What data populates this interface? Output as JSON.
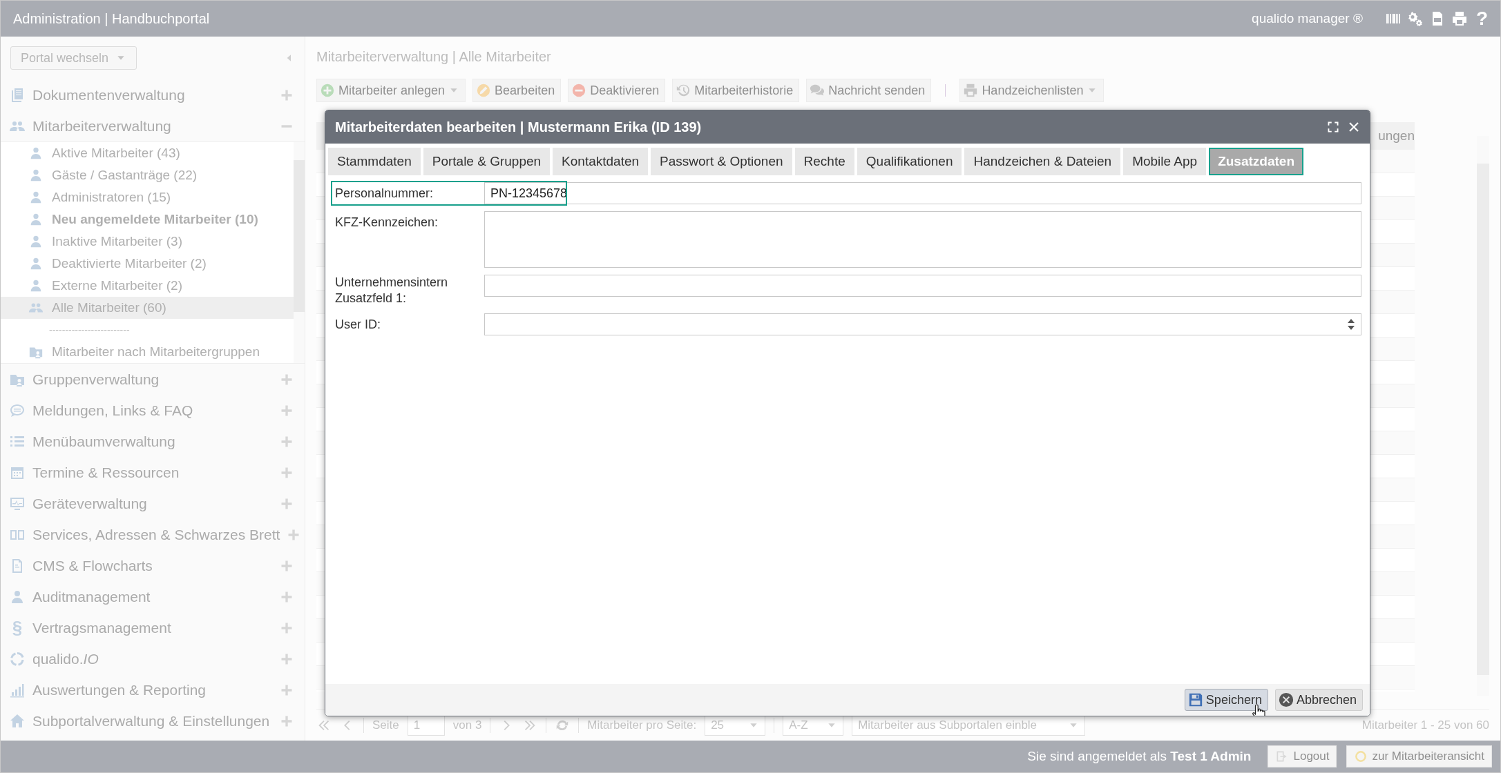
{
  "header": {
    "title": "Administration | Handbuchportal",
    "product": "qualido manager ®",
    "help": "?"
  },
  "sidebar": {
    "portal_select": "Portal wechseln",
    "sections": [
      {
        "label": "Dokumentenverwaltung",
        "expanded": false
      },
      {
        "label": "Mitarbeiterverwaltung",
        "expanded": true,
        "children": [
          {
            "kind": "item",
            "label": "Aktive Mitarbeiter (43)",
            "selected": false,
            "bold": false
          },
          {
            "kind": "item",
            "label": "Gäste / Gastanträge (22)",
            "selected": false,
            "bold": false
          },
          {
            "kind": "item",
            "label": "Administratoren (15)",
            "selected": false,
            "bold": false
          },
          {
            "kind": "item",
            "label": "Neu angemeldete Mitarbeiter (10)",
            "selected": false,
            "bold": true
          },
          {
            "kind": "item",
            "label": "Inaktive Mitarbeiter (3)",
            "selected": false,
            "bold": false
          },
          {
            "kind": "item",
            "label": "Deaktivierte Mitarbeiter (2)",
            "selected": false,
            "bold": false
          },
          {
            "kind": "item",
            "label": "Externe Mitarbeiter (2)",
            "selected": false,
            "bold": false
          },
          {
            "kind": "item",
            "label": "Alle Mitarbeiter (60)",
            "selected": true,
            "bold": false
          },
          {
            "kind": "separator",
            "label": "-------------------------"
          },
          {
            "kind": "item",
            "label": "Mitarbeiter nach Mitarbeitergruppen",
            "selected": false,
            "bold": false
          }
        ]
      },
      {
        "label": "Gruppenverwaltung",
        "expanded": false
      },
      {
        "label": "Meldungen, Links & FAQ",
        "expanded": false
      },
      {
        "label": "Menübaumverwaltung",
        "expanded": false
      },
      {
        "label": "Termine & Ressourcen",
        "expanded": false
      },
      {
        "label": "Geräteverwaltung",
        "expanded": false
      },
      {
        "label": "Services, Adressen & Schwarzes Brett",
        "expanded": false
      },
      {
        "label": "CMS & Flowcharts",
        "expanded": false
      },
      {
        "label": "Auditmanagement",
        "expanded": false
      },
      {
        "label": "Vertragsmanagement",
        "expanded": false,
        "icon_glyph": "§"
      },
      {
        "label": "qualido.*IO*",
        "expanded": false
      },
      {
        "label": "Auswertungen & Reporting",
        "expanded": false
      },
      {
        "label": "Subportalverwaltung & Einstellungen",
        "expanded": false
      }
    ]
  },
  "main": {
    "title": "Mitarbeiterverwaltung | Alle Mitarbeiter",
    "toolbar": [
      {
        "label": "Mitarbeiter anlegen",
        "dropdown": true
      },
      {
        "label": "Bearbeiten",
        "dropdown": false
      },
      {
        "label": "Deaktivieren",
        "dropdown": false
      },
      {
        "label": "Mitarbeiterhistorie",
        "dropdown": false
      },
      {
        "label": "Nachricht senden",
        "dropdown": false
      },
      {
        "label": "Handzeichenlisten",
        "dropdown": true
      }
    ],
    "table": {
      "column_header": "ungen"
    },
    "pager": {
      "page_label": "Seite",
      "page": "1",
      "of": "von 3",
      "per_page_label": "Mitarbeiter pro Seite:",
      "per_page": "25",
      "sort": "A-Z",
      "subportal": "Mitarbeiter aus Subportalen einble",
      "range": "Mitarbeiter 1 - 25 von 60"
    }
  },
  "dialog": {
    "title": "Mitarbeiterdaten bearbeiten | Mustermann Erika (ID 139)",
    "tabs": [
      {
        "label": "Stammdaten",
        "selected": false
      },
      {
        "label": "Portale & Gruppen",
        "selected": false
      },
      {
        "label": "Kontaktdaten",
        "selected": false
      },
      {
        "label": "Passwort & Optionen",
        "selected": false
      },
      {
        "label": "Rechte",
        "selected": false
      },
      {
        "label": "Qualifikationen",
        "selected": false
      },
      {
        "label": "Handzeichen & Dateien",
        "selected": false
      },
      {
        "label": "Mobile App",
        "selected": false
      },
      {
        "label": "Zusatzdaten",
        "selected": true
      }
    ],
    "fields": [
      {
        "kind": "text",
        "label": "Personalnummer:",
        "value": "PN-12345678",
        "highlighted": true
      },
      {
        "kind": "textarea",
        "label": "KFZ-Kennzeichen:",
        "highlighted": false
      },
      {
        "kind": "text",
        "label": "Unternehmensintern Zusatzfeld 1:",
        "highlighted": false
      },
      {
        "kind": "select",
        "label": "User ID:",
        "highlighted": false
      }
    ],
    "buttons": [
      {
        "label": "Speichern",
        "hovered": true
      },
      {
        "label": "Abbrechen",
        "hovered": false
      }
    ]
  },
  "status_bar": {
    "login_text": "Sie sind angemeldet als **Test 1 Admin**",
    "buttons": [
      "Logout",
      "zur Mitarbeiteransicht"
    ]
  }
}
